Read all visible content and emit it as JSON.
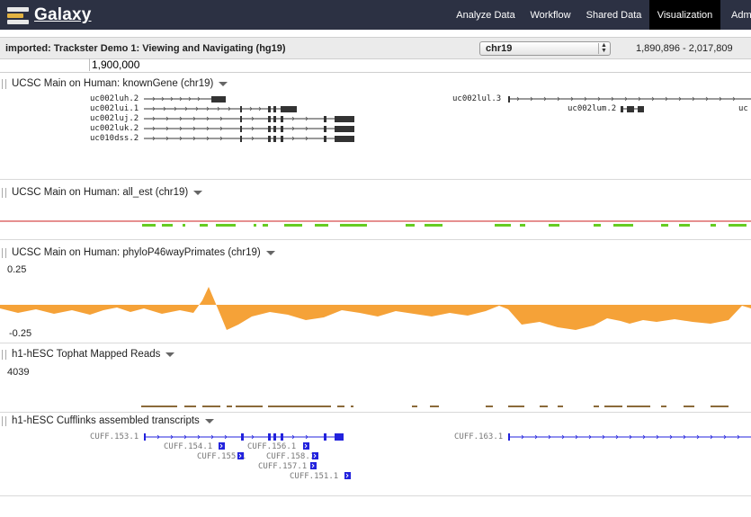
{
  "app": {
    "logo_text": "Galaxy",
    "nav": [
      "Analyze Data",
      "Workflow",
      "Shared Data",
      "Visualization",
      "Adm"
    ],
    "active_nav": "Visualization"
  },
  "viz": {
    "title": "imported: Trackster Demo 1: Viewing and Navigating (hg19)",
    "chrom": "chr19",
    "range": "1,890,896 - 2,017,809",
    "position": "1,900,000"
  },
  "tracks": [
    {
      "name": "UCSC Main on Human: knownGene (chr19)"
    },
    {
      "name": "UCSC Main on Human: all_est (chr19)"
    },
    {
      "name": "UCSC Main on Human: phyloP46wayPrimates (chr19)",
      "ymax": "0.25",
      "ymin": "-0.25"
    },
    {
      "name": "h1-hESC Tophat Mapped Reads",
      "ymax": "4039"
    },
    {
      "name": "h1-hESC Cufflinks assembled transcripts"
    }
  ],
  "genes": [
    "uc002luh.2",
    "uc002lui.1",
    "uc002luj.2",
    "uc002luk.2",
    "uc010dss.2",
    "uc002lul.3",
    "uc002lum.2"
  ],
  "cuff": [
    "CUFF.153.1",
    "CUFF.154.1",
    "CUFF.156.1",
    "CUFF.155.1",
    "CUFF.158.1",
    "CUFF.157.1",
    "CUFF.151.1",
    "CUFF.163.1"
  ],
  "colors": {
    "topbar": "#2c3143",
    "est": "#66cc22",
    "est_line": "#cc2222",
    "phylo": "#f5a238",
    "reads": "#8b6a3a",
    "cuff": "#2222dd"
  }
}
